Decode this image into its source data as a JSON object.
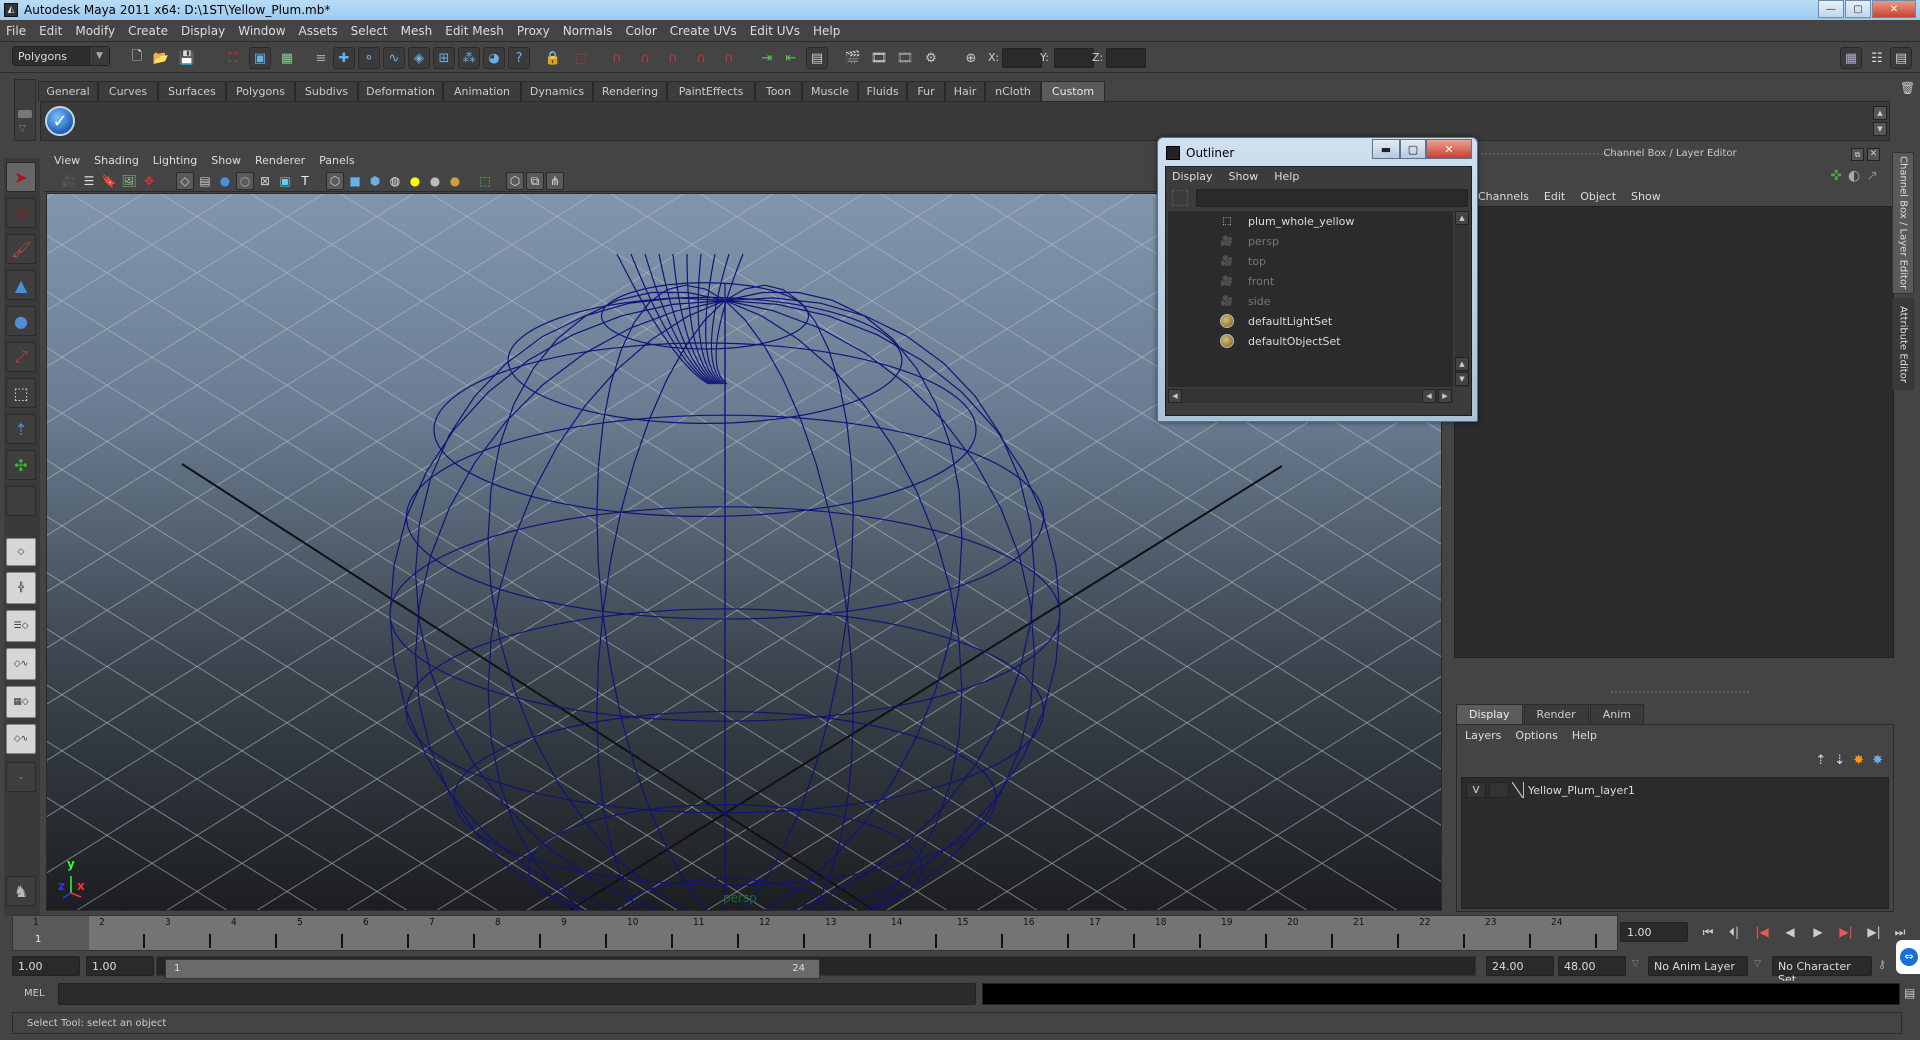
{
  "window": {
    "title": "Autodesk Maya 2011 x64: D:\\1ST\\Yellow_Plum.mb*",
    "buttons": {
      "minimize": "—",
      "maximize": "▢",
      "close": "✕"
    }
  },
  "menubar": [
    "File",
    "Edit",
    "Modify",
    "Create",
    "Display",
    "Window",
    "Assets",
    "Select",
    "Mesh",
    "Edit Mesh",
    "Proxy",
    "Normals",
    "Color",
    "Create UVs",
    "Edit UVs",
    "Help"
  ],
  "statusline": {
    "mode": "Polygons",
    "coord_labels": {
      "x": "X:",
      "y": "Y:",
      "z": "Z:"
    },
    "coord_values": {
      "x": "",
      "y": "",
      "z": ""
    }
  },
  "shelf": {
    "tabs": [
      "General",
      "Curves",
      "Surfaces",
      "Polygons",
      "Subdivs",
      "Deformation",
      "Animation",
      "Dynamics",
      "Rendering",
      "PaintEffects",
      "Toon",
      "Muscle",
      "Fluids",
      "Fur",
      "Hair",
      "nCloth",
      "Custom"
    ],
    "active_tab": "Custom",
    "items": [
      {
        "icon": "checkmark-icon"
      }
    ]
  },
  "toolbox": {
    "tools": [
      "select-tool",
      "lasso-tool",
      "paint-select-tool",
      "move-tool",
      "rotate-tool",
      "scale-tool",
      "universal-manipulator",
      "soft-modification-tool",
      "show-manipulator-tool",
      "last-used-tool"
    ],
    "selected": "select-tool"
  },
  "viewport": {
    "menus": [
      "View",
      "Shading",
      "Lighting",
      "Show",
      "Renderer",
      "Panels"
    ],
    "camera_label": "persp",
    "axis": {
      "x": "x",
      "y": "y",
      "z": "z"
    },
    "colors": {
      "wireframe": "#10137a",
      "gradient_top": "#8196ae",
      "gradient_bottom": "#1c1e21",
      "axis_x": "#ff3030",
      "axis_y": "#30ff30",
      "axis_z": "#3030ff"
    }
  },
  "outliner": {
    "title": "Outliner",
    "menus": [
      "Display",
      "Show",
      "Help"
    ],
    "filter_value": "",
    "items": [
      {
        "label": "plum_whole_yellow",
        "icon": "mesh-icon",
        "dimmed": false
      },
      {
        "label": "persp",
        "icon": "camera-icon",
        "dimmed": true
      },
      {
        "label": "top",
        "icon": "camera-icon",
        "dimmed": true
      },
      {
        "label": "front",
        "icon": "camera-icon",
        "dimmed": true
      },
      {
        "label": "side",
        "icon": "camera-icon",
        "dimmed": true
      },
      {
        "label": "defaultLightSet",
        "icon": "set-icon",
        "dimmed": false
      },
      {
        "label": "defaultObjectSet",
        "icon": "set-icon",
        "dimmed": false
      }
    ]
  },
  "channelbox": {
    "title": "Channel Box / Layer Editor",
    "menus": [
      "Channels",
      "Edit",
      "Object",
      "Show"
    ],
    "side_tabs": [
      "Channel Box / Layer Editor",
      "Attribute Editor"
    ]
  },
  "layers": {
    "tabs": [
      "Display",
      "Render",
      "Anim"
    ],
    "active_tab": "Display",
    "menus": [
      "Layers",
      "Options",
      "Help"
    ],
    "rows": [
      {
        "visible": "V",
        "name": "Yellow_Plum_layer1"
      }
    ]
  },
  "timeslider": {
    "frames": [
      "1",
      "2",
      "3",
      "4",
      "5",
      "6",
      "7",
      "8",
      "9",
      "10",
      "11",
      "12",
      "13",
      "14",
      "15",
      "16",
      "17",
      "18",
      "19",
      "20",
      "21",
      "22",
      "23",
      "24"
    ],
    "current_frame": "1",
    "current_time": "1.00"
  },
  "range": {
    "start_time": "1.00",
    "playback_start": "1.00",
    "range_start_label": "1",
    "range_end_label": "24",
    "playback_end": "24.00",
    "end_time": "48.00",
    "anim_layer": "No Anim Layer",
    "character_set": "No Character Set"
  },
  "playback": [
    "go-to-start",
    "step-back-frame",
    "step-back-key",
    "play-backwards",
    "play-forwards",
    "step-forward-key",
    "step-forward-frame",
    "go-to-end"
  ],
  "commandline": {
    "label": "MEL",
    "value": ""
  },
  "helpline": {
    "text": "Select Tool: select an object"
  }
}
